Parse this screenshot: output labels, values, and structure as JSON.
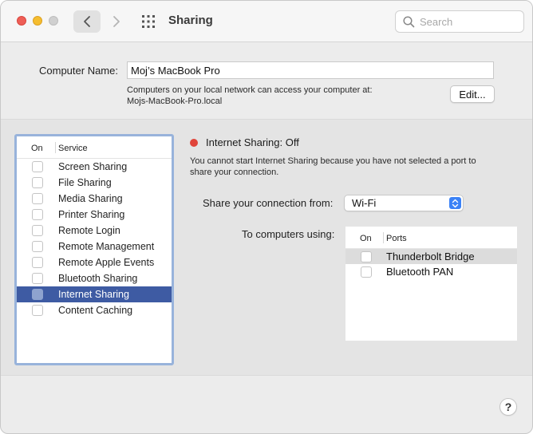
{
  "window": {
    "title": "Sharing",
    "traffic_lights": [
      "close",
      "minimize",
      "zoom"
    ],
    "nav_icons": {
      "back": "chevron-left-icon",
      "forward": "chevron-right-icon",
      "grid": "grid-icon"
    }
  },
  "search": {
    "placeholder": "Search",
    "value": ""
  },
  "computer_name": {
    "label": "Computer Name:",
    "value": "Moj’s MacBook Pro",
    "info_line1": "Computers on your local network can access your computer at:",
    "info_line2": "Mojs-MacBook-Pro.local",
    "edit_label": "Edit..."
  },
  "services": {
    "header_on": "On",
    "header_service": "Service",
    "items": [
      {
        "label": "Screen Sharing",
        "checked": false,
        "selected": false
      },
      {
        "label": "File Sharing",
        "checked": false,
        "selected": false
      },
      {
        "label": "Media Sharing",
        "checked": false,
        "selected": false
      },
      {
        "label": "Printer Sharing",
        "checked": false,
        "selected": false
      },
      {
        "label": "Remote Login",
        "checked": false,
        "selected": false
      },
      {
        "label": "Remote Management",
        "checked": false,
        "selected": false
      },
      {
        "label": "Remote Apple Events",
        "checked": false,
        "selected": false
      },
      {
        "label": "Bluetooth Sharing",
        "checked": false,
        "selected": false
      },
      {
        "label": "Internet Sharing",
        "checked": false,
        "selected": true
      },
      {
        "label": "Content Caching",
        "checked": false,
        "selected": false
      }
    ]
  },
  "detail": {
    "status_label": "Internet Sharing: Off",
    "status_color": "#e0443a",
    "description_line1": "You cannot start Internet Sharing because you have not selected a port to",
    "description_line2": "share your connection.",
    "share_from_label": "Share your connection from:",
    "share_from_value": "Wi-Fi",
    "to_computers_label": "To computers using:",
    "ports": {
      "header_on": "On",
      "header_ports": "Ports",
      "items": [
        {
          "label": "Thunderbolt Bridge",
          "checked": false,
          "highlighted": true
        },
        {
          "label": "Bluetooth PAN",
          "checked": false,
          "highlighted": false
        }
      ]
    }
  },
  "help": {
    "label": "?"
  },
  "colors": {
    "selection": "#3e5ba3",
    "focus_ring": "#98b3db",
    "accent": "#3b82f6"
  }
}
